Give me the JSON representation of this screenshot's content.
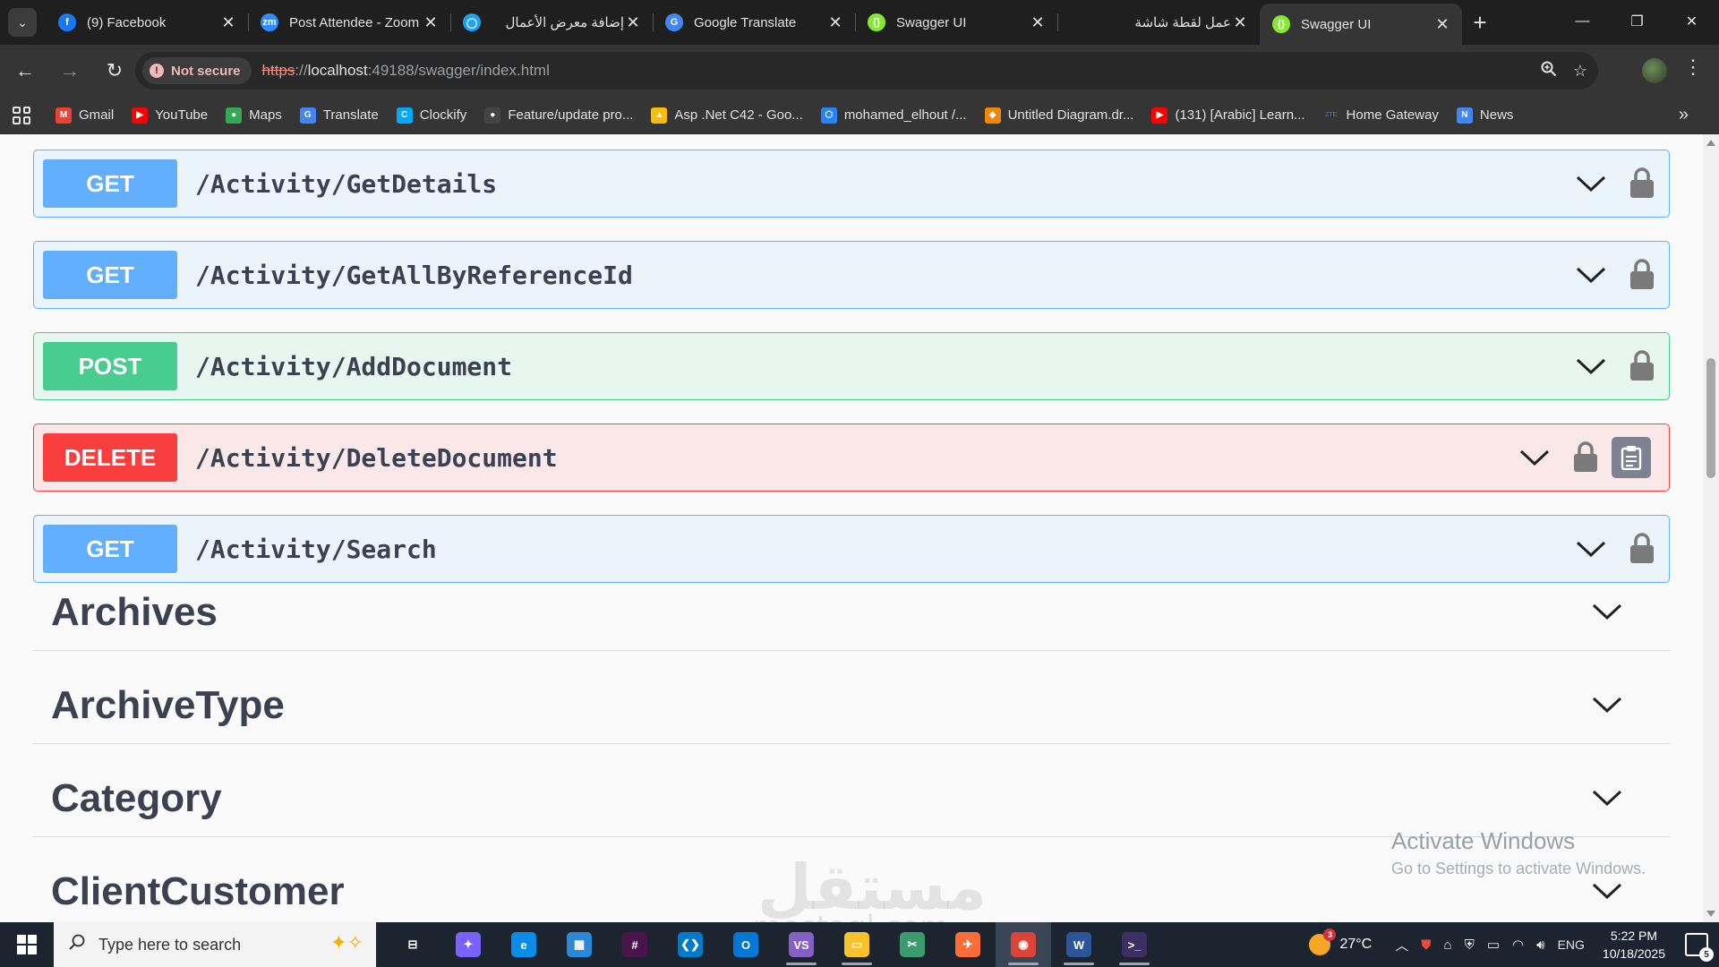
{
  "browser": {
    "tabs": [
      {
        "title": "(9) Facebook",
        "icon": "facebook-icon",
        "color": "#1877f2",
        "glyph": "f",
        "rtl": false
      },
      {
        "title": "Post Attendee - Zoom",
        "icon": "zoom-icon",
        "color": "#2d8cff",
        "glyph": "zm",
        "rtl": false
      },
      {
        "title": "إضافة معرض الأعمال",
        "icon": "mostaql-icon",
        "color": "#1da1f2",
        "glyph": "◯",
        "rtl": true
      },
      {
        "title": "Google Translate",
        "icon": "google-translate-icon",
        "color": "#4285f4",
        "glyph": "G",
        "rtl": false
      },
      {
        "title": "Swagger UI",
        "icon": "swagger-icon",
        "color": "#85ea2d",
        "glyph": "{}",
        "rtl": false
      },
      {
        "title": "عمل لقطة شاشة",
        "icon": "blank-page-icon",
        "color": "#1f1f1f",
        "glyph": "",
        "rtl": true
      },
      {
        "title": "Swagger UI",
        "icon": "swagger-icon",
        "color": "#85ea2d",
        "glyph": "{}",
        "rtl": false,
        "active": true
      }
    ],
    "security_label": "Not secure",
    "url": {
      "scheme": "https",
      "sep": "://",
      "host": "localhost",
      "rest": ":49188/swagger/index.html"
    },
    "bookmarks": [
      {
        "label": "Gmail",
        "icon": "gmail-icon",
        "color": "#ea4335",
        "glyph": "M"
      },
      {
        "label": "YouTube",
        "icon": "youtube-icon",
        "color": "#ff0000",
        "glyph": "▶"
      },
      {
        "label": "Maps",
        "icon": "maps-icon",
        "color": "#34a853",
        "glyph": "●"
      },
      {
        "label": "Translate",
        "icon": "translate-icon",
        "color": "#4285f4",
        "glyph": "G"
      },
      {
        "label": "Clockify",
        "icon": "clockify-icon",
        "color": "#03a9f4",
        "glyph": "C"
      },
      {
        "label": "Feature/update pro...",
        "icon": "github-icon",
        "color": "#444444",
        "glyph": "●"
      },
      {
        "label": "Asp .Net C42 - Goo...",
        "icon": "google-drive-icon",
        "color": "#fbbc04",
        "glyph": "▲"
      },
      {
        "label": "mohamed_elhout /...",
        "icon": "bitbucket-icon",
        "color": "#2684ff",
        "glyph": "⬡"
      },
      {
        "label": "Untitled Diagram.dr...",
        "icon": "drawio-icon",
        "color": "#f08705",
        "glyph": "◆"
      },
      {
        "label": "(131) [Arabic] Learn...",
        "icon": "youtube-icon",
        "color": "#ff0000",
        "glyph": "▶"
      },
      {
        "label": "Home Gateway",
        "icon": "zte-icon",
        "color": "#2b6cb0",
        "glyph": "ZTE"
      },
      {
        "label": "News",
        "icon": "google-news-icon",
        "color": "#4285f4",
        "glyph": "N"
      }
    ]
  },
  "swagger": {
    "operations": [
      {
        "method": "GET",
        "path": "/Activity/GetDetails",
        "kind": "get"
      },
      {
        "method": "GET",
        "path": "/Activity/GetAllByReferenceId",
        "kind": "get"
      },
      {
        "method": "POST",
        "path": "/Activity/AddDocument",
        "kind": "post"
      },
      {
        "method": "DELETE",
        "path": "/Activity/DeleteDocument",
        "kind": "delete"
      },
      {
        "method": "GET",
        "path": "/Activity/Search",
        "kind": "get"
      }
    ],
    "tags": [
      "Archives",
      "ArchiveType",
      "Category",
      "ClientCustomer"
    ],
    "colors": {
      "get": "#61affe",
      "post": "#49cc90",
      "delete": "#f93e3e"
    }
  },
  "overlay": {
    "activate_title": "Activate Windows",
    "activate_sub": "Go to Settings to activate Windows.",
    "mostaql_ar": "مستقل",
    "mostaql_en": "mostaql.com"
  },
  "taskbar": {
    "search_placeholder": "Type here to search",
    "apps": [
      {
        "name": "task-view-icon",
        "color": "#1c2430",
        "glyph": "⊟",
        "running": false
      },
      {
        "name": "copilot-icon",
        "color": "#7b61ff",
        "glyph": "✦",
        "running": false
      },
      {
        "name": "edge-icon",
        "color": "#0c8ce9",
        "glyph": "e",
        "running": false
      },
      {
        "name": "microsoft-store-icon",
        "color": "#2b88d8",
        "glyph": "▦",
        "running": false
      },
      {
        "name": "slack-icon",
        "color": "#4a154b",
        "glyph": "#",
        "running": false
      },
      {
        "name": "vscode-icon",
        "color": "#007acc",
        "glyph": "❮❯",
        "running": false
      },
      {
        "name": "outlook-icon",
        "color": "#0078d4",
        "glyph": "O",
        "running": false
      },
      {
        "name": "visual-studio-icon",
        "color": "#8661c5",
        "glyph": "VS",
        "running": true
      },
      {
        "name": "file-explorer-icon",
        "color": "#f8c22a",
        "glyph": "▭",
        "running": true
      },
      {
        "name": "snipping-tool-icon",
        "color": "#3a9b6c",
        "glyph": "✂",
        "running": false
      },
      {
        "name": "postman-icon",
        "color": "#ff6c37",
        "glyph": "✈",
        "running": false
      },
      {
        "name": "chrome-icon",
        "color": "#db4437",
        "glyph": "◉",
        "running": true,
        "active": true
      },
      {
        "name": "word-icon",
        "color": "#2b579a",
        "glyph": "W",
        "running": true
      },
      {
        "name": "terminal-icon",
        "color": "#3b2f63",
        "glyph": ">_",
        "running": true
      }
    ],
    "weather_temp": "27°C",
    "weather_badge": "3",
    "language": "ENG",
    "time": "5:22 PM",
    "date": "10/18/2025",
    "notifications": "5"
  }
}
